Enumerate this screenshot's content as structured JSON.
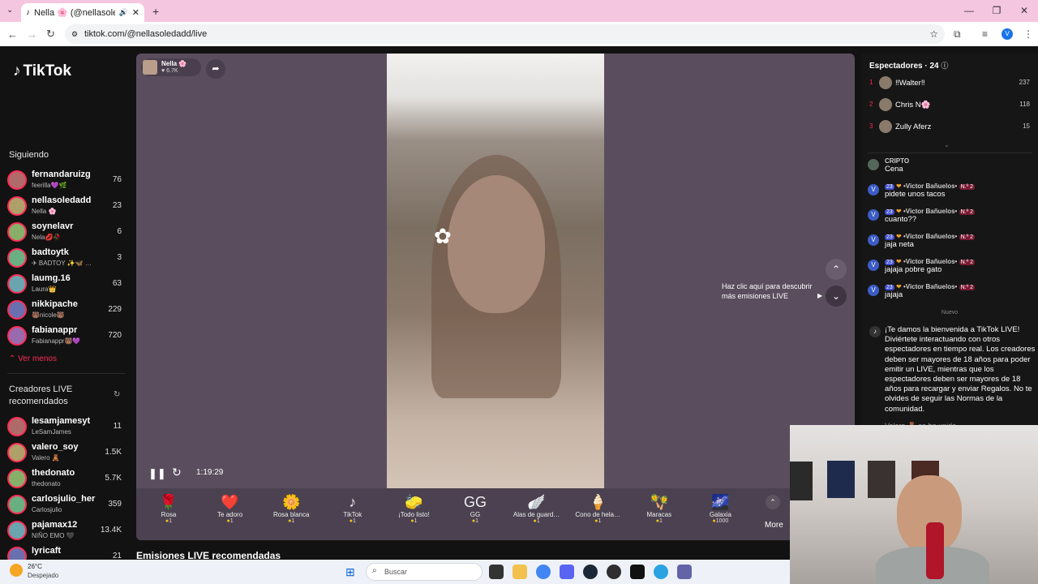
{
  "browser": {
    "tab_title": "Nella 🌸 (@nellasoledadd)",
    "url": "tiktok.com/@nellasoledadd/live"
  },
  "sidebar": {
    "logo": "TikTok",
    "following_title": "Siguiendo",
    "following": [
      {
        "name": "fernandaruizg",
        "sub": "feerilla💜🌿",
        "count": "76"
      },
      {
        "name": "nellasoledadd",
        "sub": "Nella 🌸",
        "count": "23"
      },
      {
        "name": "soynelavr",
        "sub": "Nela💋🥀",
        "count": "6"
      },
      {
        "name": "badtoytk",
        "sub": "✈ BADTOY ✨🦋 …",
        "count": "3"
      },
      {
        "name": "laumg.16",
        "sub": "Laura👑",
        "count": "63"
      },
      {
        "name": "nikkipache",
        "sub": "🐻nicole🐻",
        "count": "229"
      },
      {
        "name": "fabianappr",
        "sub": "Fabianappr🐻💜",
        "count": "720"
      }
    ],
    "see_less": "Ver menos",
    "recommended_title": "Creadores LIVE recomendados",
    "recommended": [
      {
        "name": "lesamjamesyt",
        "sub": "LeSamJames",
        "count": "11"
      },
      {
        "name": "valero_soy",
        "sub": "Valero 🧸",
        "count": "1.5K"
      },
      {
        "name": "thedonato",
        "sub": "thedonato",
        "count": "5.7K"
      },
      {
        "name": "carlosjulio_her",
        "sub": "Carlosjulio",
        "count": "359"
      },
      {
        "name": "pajamax12",
        "sub": "NIÑO EMO 🖤",
        "count": "13.4K"
      },
      {
        "name": "lyricaft",
        "sub": "",
        "count": "21"
      }
    ]
  },
  "live": {
    "host_name": "Nella 🌸",
    "host_likes": "♥ 6.7K",
    "timer": "1:19:29",
    "discover_text": "Haz clic aquí para descubrir más emisiones LIVE",
    "recommended_heading": "Emisiones LIVE recomendadas",
    "more_label": "More",
    "gifts": [
      {
        "icon": "🌹",
        "name": "Rosa",
        "price": "1"
      },
      {
        "icon": "❤️",
        "name": "Te adoro",
        "price": "1"
      },
      {
        "icon": "🌼",
        "name": "Rosa blanca",
        "price": "1"
      },
      {
        "icon": "♪",
        "name": "TikTok",
        "price": "1"
      },
      {
        "icon": "🧽",
        "name": "¡Todo listo!",
        "price": "1"
      },
      {
        "icon": "GG",
        "name": "GG",
        "price": "1"
      },
      {
        "icon": "🪽",
        "name": "Alas de guard…",
        "price": "1"
      },
      {
        "icon": "🍦",
        "name": "Cono de hela…",
        "price": "1"
      },
      {
        "icon": "🪇",
        "name": "Maracas",
        "price": "1"
      },
      {
        "icon": "🌌",
        "name": "Galaxia",
        "price": "1000"
      }
    ]
  },
  "viewers": {
    "title": "Espectadores · 24",
    "list": [
      {
        "rank": "1",
        "name": "‼Walter‼",
        "score": "237"
      },
      {
        "rank": "2",
        "name": "Chris N🌸",
        "score": "118"
      },
      {
        "rank": "3",
        "name": "Zully Aferz",
        "score": "15"
      }
    ]
  },
  "chat": {
    "messages": [
      {
        "user": "CRIPTO",
        "badges": "",
        "text": "Cena"
      },
      {
        "user": "•Victor Bañuelos•",
        "badges": "23",
        "tag": "N.º 2",
        "text": "pidete unos tacos"
      },
      {
        "user": "•Victor Bañuelos•",
        "badges": "23",
        "tag": "N.º 2",
        "text": "cuanto??"
      },
      {
        "user": "•Victor Bañuelos•",
        "badges": "23",
        "tag": "N.º 2",
        "text": "jaja neta"
      },
      {
        "user": "•Victor Bañuelos•",
        "badges": "23",
        "tag": "N.º 2",
        "text": "jajaja pobre gato"
      },
      {
        "user": "•Victor Bañuelos•",
        "badges": "23",
        "tag": "N.º 2",
        "text": "jajaja"
      }
    ],
    "new_label": "Nuevo",
    "welcome": "¡Te damos la bienvenida a TikTok LIVE! Diviértete interactuando con otros espectadores en tiempo real. Los creadores deben ser mayores de 18 años para poder emitir un LIVE, mientras que los espectadores deben ser mayores de 18 años para recargar y enviar Regalos. No te olvides de seguir las Normas de la comunidad.",
    "partial": "Valero 🧸 se ha unido"
  },
  "taskbar": {
    "weather_temp": "26°C",
    "weather_desc": "Despejado",
    "search": "Buscar"
  },
  "colors": {
    "accent": "#fe2c55",
    "panel": "#5a4e5e",
    "tabbar": "#f5c6e0"
  }
}
